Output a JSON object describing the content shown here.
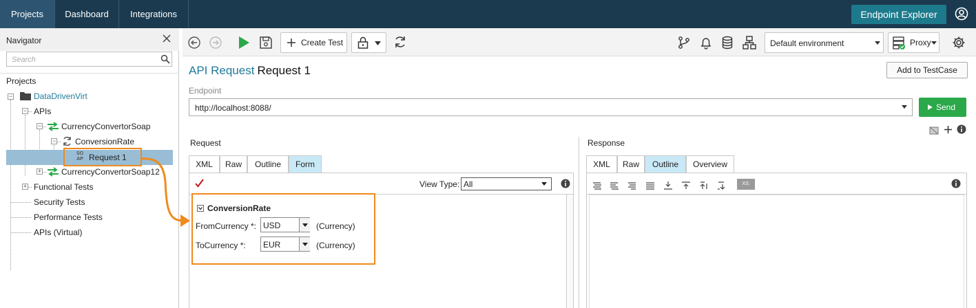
{
  "topbar": {
    "tabs": [
      {
        "label": "Projects",
        "active": true
      },
      {
        "label": "Dashboard",
        "active": false
      },
      {
        "label": "Integrations",
        "active": false
      }
    ],
    "endpoint_explorer": "Endpoint Explorer"
  },
  "navigator": {
    "title": "Navigator",
    "search_placeholder": "Search",
    "projects_label": "Projects",
    "tree": {
      "project": "DataDrivenVirt",
      "apis": "APIs",
      "service1": "CurrencyConvertorSoap",
      "operation": "ConversionRate",
      "request": "Request 1",
      "request_badge_top": "SO",
      "request_badge_bottom": "AP",
      "service2": "CurrencyConvertorSoap12",
      "functional_tests": "Functional Tests",
      "security_tests": "Security Tests",
      "performance_tests": "Performance Tests",
      "apis_virtual": "APIs (Virtual)"
    }
  },
  "toolbar": {
    "create_test": "Create Test",
    "environment": "Default environment",
    "proxy": "Proxy"
  },
  "page": {
    "title_prefix": "API Request",
    "title_name": "Request 1",
    "add_to_testcase": "Add to TestCase",
    "endpoint_label": "Endpoint",
    "endpoint_value": "http://localhost:8088/",
    "send": "Send"
  },
  "request": {
    "label": "Request",
    "tabs": [
      "XML",
      "Raw",
      "Outline",
      "Form"
    ],
    "active_tab": "Form",
    "view_type_label": "View Type:",
    "view_type_value": "All",
    "form_title": "ConversionRate",
    "fields": [
      {
        "label": "FromCurrency *:",
        "value": "USD",
        "type": "(Currency)"
      },
      {
        "label": "ToCurrency *:",
        "value": "EUR",
        "type": "(Currency)"
      }
    ]
  },
  "response": {
    "label": "Response",
    "tabs": [
      "XML",
      "Raw",
      "Outline",
      "Overview"
    ],
    "active_tab": "Outline",
    "xs_badge": "XS:"
  },
  "colors": {
    "topbar": "#1b3a4f",
    "accent_teal": "#1d7a8c",
    "link": "#1f7a9c",
    "send_green": "#2aa84a",
    "highlight_orange": "#f08a1c",
    "selection": "#99bdd5",
    "active_tab": "#c9e9f7"
  }
}
